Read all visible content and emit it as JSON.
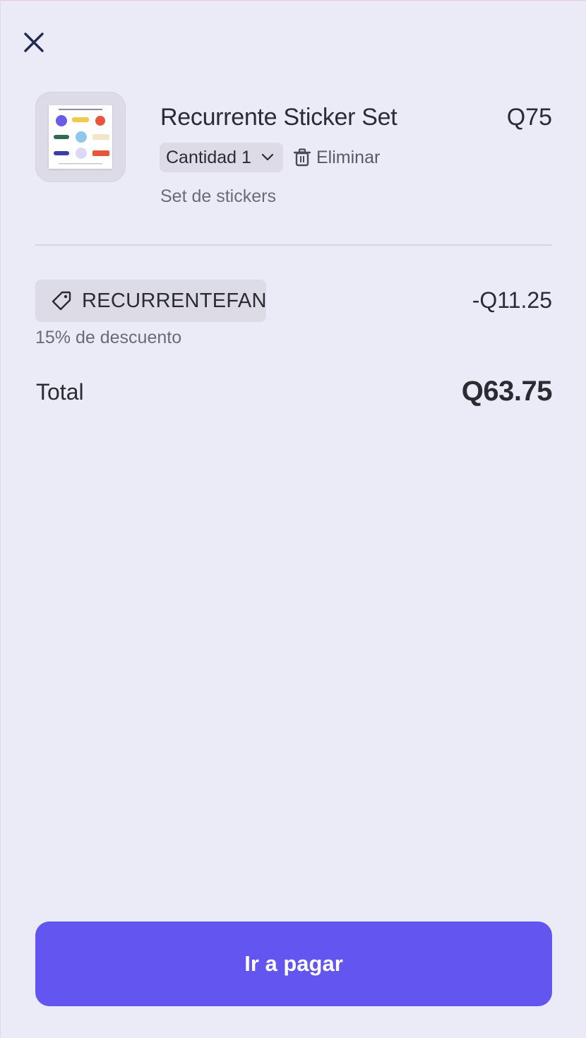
{
  "cart": {
    "item": {
      "title": "Recurrente Sticker Set",
      "price": "Q75",
      "quantity_label": "Cantidad 1",
      "remove_label": "Eliminar",
      "description": "Set de stickers"
    },
    "coupon": {
      "code": "RECURRENTEFAN",
      "discount_amount": "-Q11.25",
      "discount_note": "15% de descuento"
    },
    "total": {
      "label": "Total",
      "value": "Q63.75"
    },
    "checkout_label": "Ir a pagar"
  },
  "icons": {
    "close": "close-icon",
    "chevron": "chevron-down-icon",
    "remove": "trash-icon",
    "coupon": "tag-icon"
  },
  "colors": {
    "background": "#ebebf7",
    "accent": "#6355ef",
    "chip": "#dcdbe6",
    "text": "#2b2b33",
    "muted_text": "#6b6b78"
  }
}
